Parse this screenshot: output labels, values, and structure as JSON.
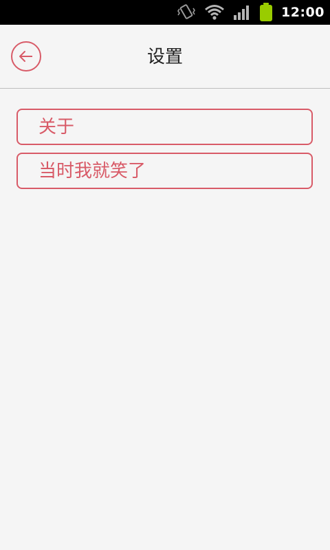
{
  "status_bar": {
    "time": "12:00",
    "icons": [
      "vibrate-icon",
      "wifi-icon",
      "signal-icon",
      "battery-icon"
    ],
    "battery_color": "#99cc00"
  },
  "header": {
    "title": "设置",
    "back_icon": "back-arrow-icon"
  },
  "menu": {
    "items": [
      {
        "label": "关于"
      },
      {
        "label": "当时我就笑了"
      }
    ]
  },
  "colors": {
    "accent": "#d85a67",
    "background": "#f5f5f5",
    "title_text": "#222222"
  }
}
